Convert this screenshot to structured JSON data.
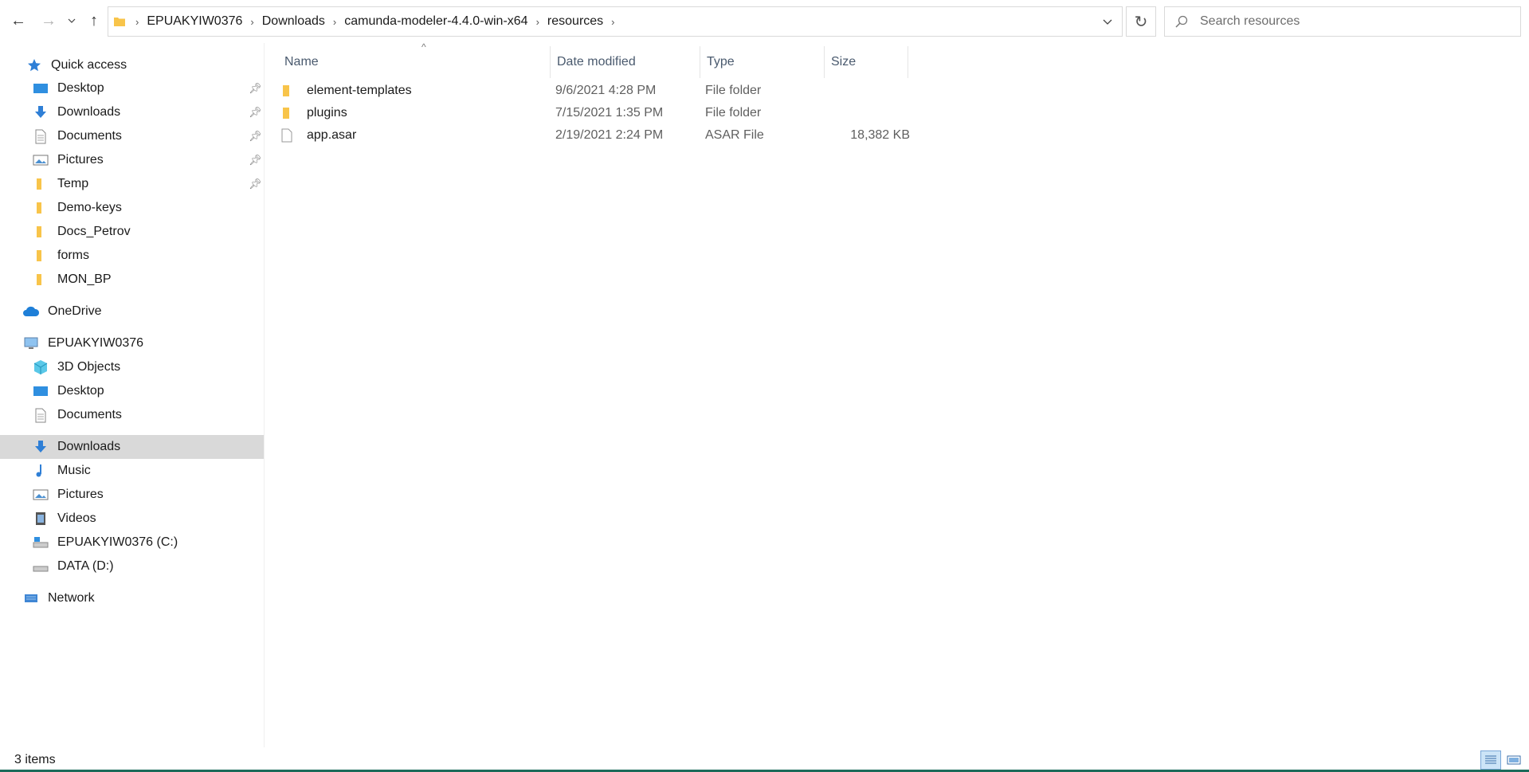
{
  "toolbar": {
    "back_label": "←",
    "forward_label": "→",
    "recent_label": "⌄",
    "up_label": "↑",
    "refresh_label": "↻"
  },
  "breadcrumb": [
    "EPUAKYIW0376",
    "Downloads",
    "camunda-modeler-4.4.0-win-x64",
    "resources"
  ],
  "search": {
    "placeholder": "Search resources",
    "value": ""
  },
  "sidebar": {
    "quick_access": {
      "label": "Quick access",
      "items": [
        {
          "label": "Desktop",
          "icon": "desktop-icon",
          "pinned": true
        },
        {
          "label": "Downloads",
          "icon": "download-icon",
          "pinned": true
        },
        {
          "label": "Documents",
          "icon": "document-icon",
          "pinned": true
        },
        {
          "label": "Pictures",
          "icon": "picture-icon",
          "pinned": true
        },
        {
          "label": "Temp",
          "icon": "folder-icon",
          "pinned": true
        },
        {
          "label": "Demo-keys",
          "icon": "folder-icon",
          "pinned": false
        },
        {
          "label": "Docs_Petrov",
          "icon": "folder-icon",
          "pinned": false
        },
        {
          "label": "forms",
          "icon": "folder-icon",
          "pinned": false
        },
        {
          "label": "MON_BP",
          "icon": "folder-icon",
          "pinned": false
        }
      ]
    },
    "onedrive": {
      "label": "OneDrive"
    },
    "this_pc": {
      "label": "EPUAKYIW0376",
      "items": [
        {
          "label": "3D Objects",
          "icon": "3d-objects-icon"
        },
        {
          "label": "Desktop",
          "icon": "desktop-icon"
        },
        {
          "label": "Documents",
          "icon": "document-icon"
        },
        {
          "label": "Downloads",
          "icon": "download-icon",
          "selected": true
        },
        {
          "label": "Music",
          "icon": "music-icon"
        },
        {
          "label": "Pictures",
          "icon": "picture-icon"
        },
        {
          "label": "Videos",
          "icon": "video-icon"
        },
        {
          "label": "EPUAKYIW0376 (C:)",
          "icon": "system-drive-icon"
        },
        {
          "label": "DATA (D:)",
          "icon": "drive-icon"
        }
      ]
    },
    "network": {
      "label": "Network"
    }
  },
  "columns": {
    "name": "Name",
    "date": "Date modified",
    "type": "Type",
    "size": "Size"
  },
  "files": [
    {
      "name": "element-templates",
      "date": "9/6/2021 4:28 PM",
      "type": "File folder",
      "size": "",
      "icon": "folder-icon"
    },
    {
      "name": "plugins",
      "date": "7/15/2021 1:35 PM",
      "type": "File folder",
      "size": "",
      "icon": "folder-icon"
    },
    {
      "name": "app.asar",
      "date": "2/19/2021 2:24 PM",
      "type": "ASAR File",
      "size": "18,382 KB",
      "icon": "file-icon"
    }
  ],
  "status": {
    "item_count": "3 items"
  },
  "colors": {
    "folder": "#f8c44a",
    "selected": "#d9d9d9",
    "accent": "#1b6b5a",
    "header_text": "#4a5a6e"
  }
}
